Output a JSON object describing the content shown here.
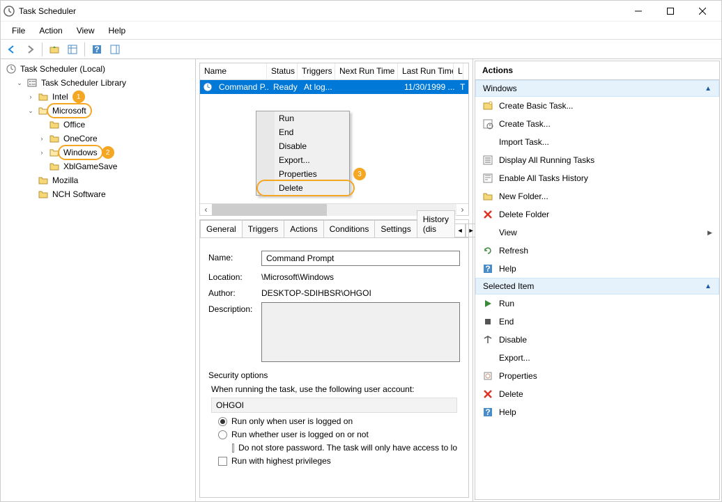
{
  "window": {
    "title": "Task Scheduler",
    "min": "Minimize",
    "max": "Maximize",
    "close": "Close"
  },
  "menubar": {
    "file": "File",
    "action": "Action",
    "view": "View",
    "help": "Help"
  },
  "tree": {
    "root": "Task Scheduler (Local)",
    "library": "Task Scheduler Library",
    "intel": "Intel",
    "microsoft": "Microsoft",
    "office": "Office",
    "onecore": "OneCore",
    "windows": "Windows",
    "xbl": "XblGameSave",
    "mozilla": "Mozilla",
    "nch": "NCH Software"
  },
  "badges": {
    "n1": "1",
    "n2": "2",
    "n3": "3"
  },
  "task_list": {
    "cols": {
      "name": "Name",
      "status": "Status",
      "triggers": "Triggers",
      "next": "Next Run Time",
      "last": "Last Run Time",
      "l": "L"
    },
    "row": {
      "name": "Command P...",
      "status": "Ready",
      "triggers": "At log...",
      "next": "",
      "last": "11/30/1999 ...",
      "l": "T"
    }
  },
  "context_menu": {
    "run": "Run",
    "end": "End",
    "disable": "Disable",
    "export": "Export...",
    "properties": "Properties",
    "delete": "Delete"
  },
  "details": {
    "tabs": {
      "general": "General",
      "triggers": "Triggers",
      "actions": "Actions",
      "conditions": "Conditions",
      "settings": "Settings",
      "history": "History (dis"
    },
    "name_label": "Name:",
    "name_value": "Command Prompt",
    "location_label": "Location:",
    "location_value": "\\Microsoft\\Windows",
    "author_label": "Author:",
    "author_value": "DESKTOP-SDIHBSR\\OHGOI",
    "description_label": "Description:",
    "security_options": "Security options",
    "sec_line": "When running the task, use the following user account:",
    "sec_user": "OHGOI",
    "radio1": "Run only when user is logged on",
    "radio2": "Run whether user is logged on or not",
    "check1": "Do not store password.  The task will only have access to lo",
    "check2": "Run with highest privileges"
  },
  "actions": {
    "header": "Actions",
    "section1": "Windows",
    "items1": {
      "create_basic": "Create Basic Task...",
      "create_task": "Create Task...",
      "import": "Import Task...",
      "display_all": "Display All Running Tasks",
      "enable_hist": "Enable All Tasks History",
      "new_folder": "New Folder...",
      "delete_folder": "Delete Folder",
      "view": "View",
      "refresh": "Refresh",
      "help": "Help"
    },
    "section2": "Selected Item",
    "items2": {
      "run": "Run",
      "end": "End",
      "disable": "Disable",
      "export": "Export...",
      "properties": "Properties",
      "delete": "Delete",
      "help": "Help"
    }
  }
}
